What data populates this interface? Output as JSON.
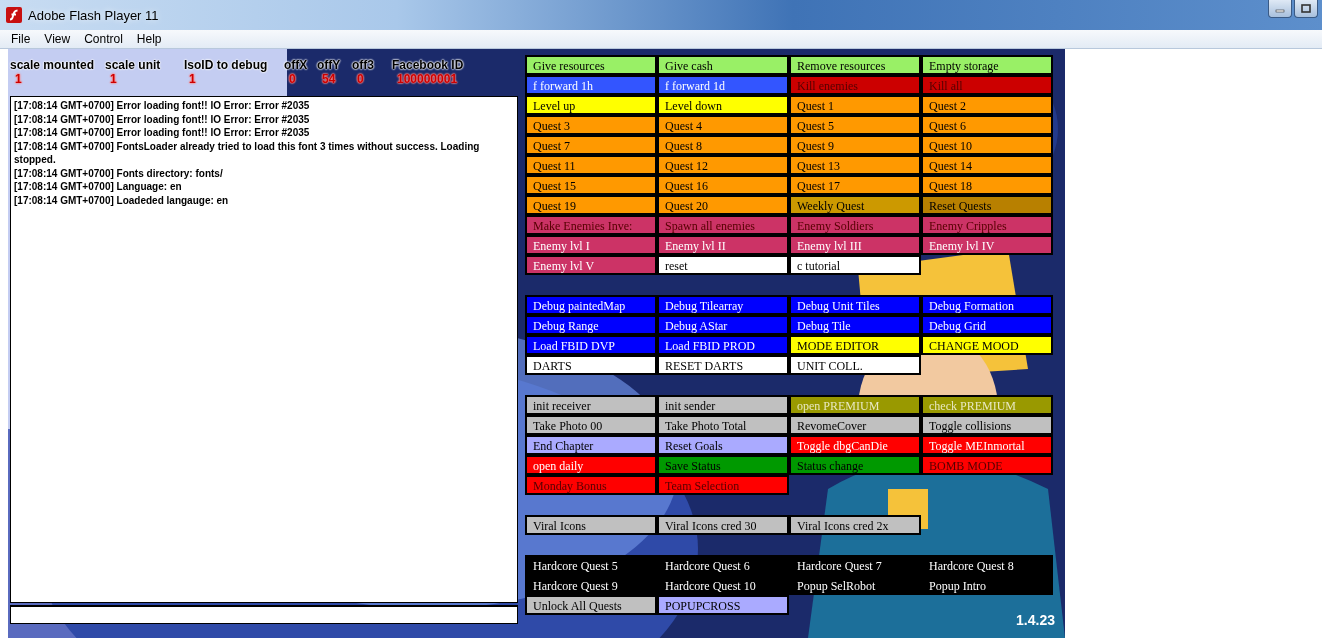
{
  "window": {
    "title": "Adobe Flash Player 11"
  },
  "menu": [
    "File",
    "View",
    "Control",
    "Help"
  ],
  "debug_fields": [
    {
      "label": "scale mounted",
      "value": "1"
    },
    {
      "label": "scale unit",
      "value": "1"
    },
    {
      "label": "IsoID to debug",
      "value": "1"
    },
    {
      "label": "offX",
      "value": "0"
    },
    {
      "label": "offY",
      "value": "54"
    },
    {
      "label": "off3",
      "value": "0"
    },
    {
      "label": "Facebook ID",
      "value": "100000001"
    }
  ],
  "log": {
    "lines": [
      "[17:08:14 GMT+0700] Error loading font!! IO Error: Error #2035",
      "[17:08:14 GMT+0700] Error loading font!! IO Error: Error #2035",
      "[17:08:14 GMT+0700] Error loading font!! IO Error: Error #2035",
      "[17:08:14 GMT+0700] FontsLoader already tried to load this font 3 times without success. Loading stopped.",
      "[17:08:14 GMT+0700] Fonts directory: fonts/",
      "[17:08:14 GMT+0700] Language: en",
      "[17:08:14 GMT+0700] Loadeded langauge: en"
    ]
  },
  "button_groups": [
    {
      "buttons": [
        {
          "label": "Give resources",
          "color": "#99f066",
          "kind": "dark"
        },
        {
          "label": "Give cash",
          "color": "#99f066",
          "kind": "dark"
        },
        {
          "label": "Remove resources",
          "color": "#99f066",
          "kind": "dark"
        },
        {
          "label": "Empty storage",
          "color": "#99f066",
          "kind": "dark"
        },
        {
          "label": "f forward 1h",
          "color": "#3355ff",
          "kind": "light"
        },
        {
          "label": "f forward 1d",
          "color": "#3355ff",
          "kind": "light"
        },
        {
          "label": "Kill enemies",
          "color": "#cc0000",
          "kind": "maroon"
        },
        {
          "label": "Kill all",
          "color": "#cc0000",
          "kind": "maroon"
        },
        {
          "label": "Level up",
          "color": "#ffff00",
          "kind": "dark"
        },
        {
          "label": "Level down",
          "color": "#ffff00",
          "kind": "dark"
        },
        {
          "label": "Quest 1",
          "color": "#ff9900",
          "kind": "dark"
        },
        {
          "label": "Quest 2",
          "color": "#ff9900",
          "kind": "dark"
        },
        {
          "label": "Quest 3",
          "color": "#ff9900",
          "kind": "dark"
        },
        {
          "label": "Quest 4",
          "color": "#ff9900",
          "kind": "dark"
        },
        {
          "label": "Quest 5",
          "color": "#ff9900",
          "kind": "dark"
        },
        {
          "label": "Quest 6",
          "color": "#ff9900",
          "kind": "dark"
        },
        {
          "label": "Quest 7",
          "color": "#ff9900",
          "kind": "dark"
        },
        {
          "label": "Quest 8",
          "color": "#ff9900",
          "kind": "dark"
        },
        {
          "label": "Quest 9",
          "color": "#ff9900",
          "kind": "dark"
        },
        {
          "label": "Quest 10",
          "color": "#ff9900",
          "kind": "dark"
        },
        {
          "label": "Quest 11",
          "color": "#ff9900",
          "kind": "dark"
        },
        {
          "label": "Quest 12",
          "color": "#ff9900",
          "kind": "dark"
        },
        {
          "label": "Quest 13",
          "color": "#ff9900",
          "kind": "dark"
        },
        {
          "label": "Quest 14",
          "color": "#ff9900",
          "kind": "dark"
        },
        {
          "label": "Quest 15",
          "color": "#ff9900",
          "kind": "dark"
        },
        {
          "label": "Quest 16",
          "color": "#ff9900",
          "kind": "dark"
        },
        {
          "label": "Quest 17",
          "color": "#ff9900",
          "kind": "dark"
        },
        {
          "label": "Quest 18",
          "color": "#ff9900",
          "kind": "dark"
        },
        {
          "label": "Quest 19",
          "color": "#ff9900",
          "kind": "dark"
        },
        {
          "label": "Quest 20",
          "color": "#ff9900",
          "kind": "dark"
        },
        {
          "label": "Weekly Quest",
          "color": "#cc9900",
          "kind": "dark"
        },
        {
          "label": "Reset Quests",
          "color": "#b88000",
          "kind": "dark"
        },
        {
          "label": "Make Enemies Inve:",
          "color": "#cc3366",
          "kind": "maroon"
        },
        {
          "label": "Spawn all enemies",
          "color": "#cc3366",
          "kind": "maroon"
        },
        {
          "label": "Enemy Soldiers",
          "color": "#cc3366",
          "kind": "maroon"
        },
        {
          "label": "Enemy Cripples",
          "color": "#cc3366",
          "kind": "maroon"
        },
        {
          "label": "Enemy lvl I",
          "color": "#cc3366",
          "kind": "light"
        },
        {
          "label": "Enemy lvl II",
          "color": "#cc3366",
          "kind": "light"
        },
        {
          "label": "Enemy lvl III",
          "color": "#cc3366",
          "kind": "light"
        },
        {
          "label": "Enemy lvl IV",
          "color": "#cc3366",
          "kind": "light"
        },
        {
          "label": "Enemy lvl V",
          "color": "#cc3366",
          "kind": "light"
        },
        {
          "label": "reset",
          "color": "#ffffff",
          "kind": "dark"
        },
        {
          "label": "c tutorial",
          "color": "#ffffff",
          "kind": "dark"
        }
      ]
    },
    {
      "buttons": [
        {
          "label": "Debug paintedMap",
          "color": "#0000ff",
          "kind": "light"
        },
        {
          "label": "Debug Tilearray",
          "color": "#0000ff",
          "kind": "light"
        },
        {
          "label": "Debug Unit Tiles",
          "color": "#0000ff",
          "kind": "light"
        },
        {
          "label": "Debug Formation",
          "color": "#0000ff",
          "kind": "light"
        },
        {
          "label": "Debug Range",
          "color": "#0000ff",
          "kind": "light"
        },
        {
          "label": "Debug AStar",
          "color": "#0000ff",
          "kind": "light"
        },
        {
          "label": "Debug Tile",
          "color": "#0000ff",
          "kind": "light"
        },
        {
          "label": "Debug Grid",
          "color": "#0000ff",
          "kind": "light"
        },
        {
          "label": "Load FBID DVP",
          "color": "#0000ff",
          "kind": "light"
        },
        {
          "label": "Load FBID PROD",
          "color": "#0000ff",
          "kind": "light"
        },
        {
          "label": "MODE EDITOR",
          "color": "#ffff00",
          "kind": "dark"
        },
        {
          "label": "CHANGE MOOD",
          "color": "#ffff00",
          "kind": "dark"
        },
        {
          "label": "DARTS",
          "color": "#ffffff",
          "kind": "dark"
        },
        {
          "label": "RESET DARTS",
          "color": "#ffffff",
          "kind": "dark"
        },
        {
          "label": "UNIT COLL.",
          "color": "#ffffff",
          "kind": "dark"
        }
      ]
    },
    {
      "buttons": [
        {
          "label": "init receiver",
          "color": "#c0c0c0",
          "kind": "dark"
        },
        {
          "label": "init sender",
          "color": "#c0c0c0",
          "kind": "dark"
        },
        {
          "label": "open PREMIUM",
          "color": "#999900",
          "kind": "pale"
        },
        {
          "label": "check PREMIUM",
          "color": "#999900",
          "kind": "pale"
        },
        {
          "label": "Take Photo 00",
          "color": "#c0c0c0",
          "kind": "dark"
        },
        {
          "label": "Take Photo Total",
          "color": "#c0c0c0",
          "kind": "dark"
        },
        {
          "label": "RevomeCover",
          "color": "#c0c0c0",
          "kind": "dark"
        },
        {
          "label": "Toggle collisions",
          "color": "#c0c0c0",
          "kind": "dark"
        },
        {
          "label": "End Chapter",
          "color": "#aaaaff",
          "kind": "dark"
        },
        {
          "label": "Reset Goals",
          "color": "#aaaaff",
          "kind": "dark"
        },
        {
          "label": "Toggle dbgCanDie",
          "color": "#ff0000",
          "kind": "light"
        },
        {
          "label": "Toggle MEInmortal",
          "color": "#ff0000",
          "kind": "light"
        },
        {
          "label": "open daily",
          "color": "#ff0000",
          "kind": "light"
        },
        {
          "label": "Save Status",
          "color": "#009900",
          "kind": "dark"
        },
        {
          "label": "Status change",
          "color": "#009900",
          "kind": "dark"
        },
        {
          "label": "BOMB MODE",
          "color": "#ff0000",
          "kind": "maroon"
        },
        {
          "label": "Monday Bonus",
          "color": "#ff0000",
          "kind": "maroon"
        },
        {
          "label": "Team Selection",
          "color": "#ff0000",
          "kind": "maroon"
        }
      ]
    },
    {
      "buttons": [
        {
          "label": "Viral Icons",
          "color": "#c0c0c0",
          "kind": "dark"
        },
        {
          "label": "Viral Icons cred 30",
          "color": "#c0c0c0",
          "kind": "dark"
        },
        {
          "label": "Viral Icons cred 2x",
          "color": "#c0c0c0",
          "kind": "dark"
        }
      ]
    },
    {
      "buttons": [
        {
          "label": "Hardcore Quest 5",
          "color": "#000000",
          "kind": "light"
        },
        {
          "label": "Hardcore Quest 6",
          "color": "#000000",
          "kind": "light"
        },
        {
          "label": "Hardcore Quest 7",
          "color": "#000000",
          "kind": "light"
        },
        {
          "label": "Hardcore Quest 8",
          "color": "#000000",
          "kind": "light"
        },
        {
          "label": "Hardcore Quest 9",
          "color": "#000000",
          "kind": "light"
        },
        {
          "label": "Hardcore Quest 10",
          "color": "#000000",
          "kind": "light"
        },
        {
          "label": "Popup SelRobot",
          "color": "#000000",
          "kind": "light"
        },
        {
          "label": "Popup Intro",
          "color": "#000000",
          "kind": "light"
        },
        {
          "label": "Unlock All Quests",
          "color": "#c0c0c0",
          "kind": "dark"
        },
        {
          "label": "POPUPCROSS",
          "color": "#aaaaff",
          "kind": "dark"
        }
      ]
    }
  ],
  "version": "1.4.23"
}
